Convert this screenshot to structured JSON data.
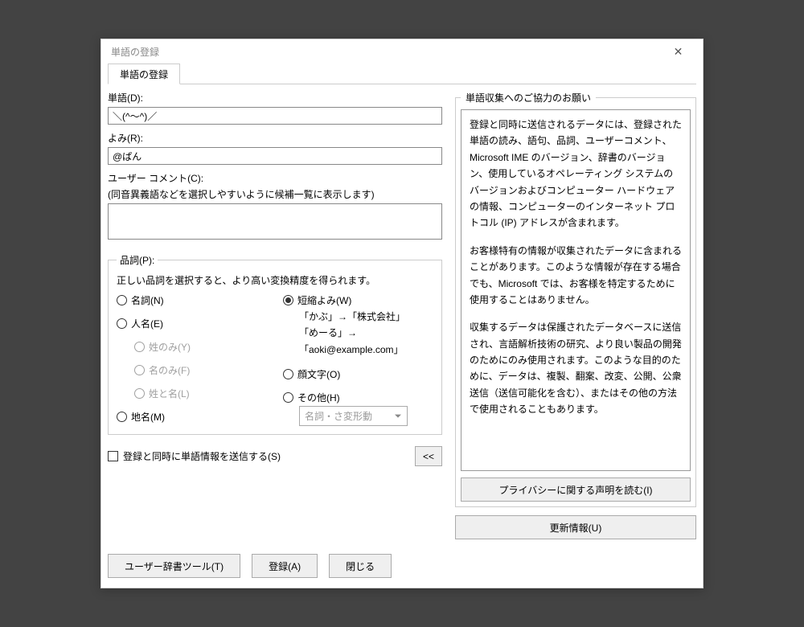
{
  "window": {
    "title": "単語の登録"
  },
  "tab": {
    "label": "単語の登録"
  },
  "fields": {
    "word_label": "単語(D):",
    "word_value": "＼(^～^)／",
    "yomi_label": "よみ(R):",
    "yomi_value": "@ぱん",
    "comment_label": "ユーザー コメント(C):",
    "comment_hint": "(同音異義語などを選択しやすいように候補一覧に表示します)",
    "comment_value": ""
  },
  "pos": {
    "legend": "品詞(P):",
    "instruction": "正しい品詞を選択すると、より高い変換精度を得られます。",
    "options": {
      "noun": "名詞(N)",
      "person": "人名(E)",
      "person_sei": "姓のみ(Y)",
      "person_mei": "名のみ(F)",
      "person_both": "姓と名(L)",
      "place": "地名(M)",
      "abbrev": "短縮よみ(W)",
      "abbrev_ex1": "「かぶ」→「株式会社」",
      "abbrev_ex2": "「めーる」→「aoki@example.com」",
      "kaomoji": "顔文字(O)",
      "other": "その他(H)",
      "subtype_placeholder": "名詞・さ変形動"
    },
    "selected": "abbrev"
  },
  "send_checkbox": "登録と同時に単語情報を送信する(S)",
  "collapse_label": "<<",
  "right": {
    "legend": "単語収集へのご協力のお願い",
    "paragraphs": [
      "登録と同時に送信されるデータには、登録された単語の読み、語句、品詞、ユーザーコメント、Microsoft IME のバージョン、辞書のバージョン、使用しているオペレーティング システムのバージョンおよびコンピューター ハードウェアの情報、コンピューターのインターネット プロトコル (IP) アドレスが含まれます。",
      "お客様特有の情報が収集されたデータに含まれることがあります。このような情報が存在する場合でも、Microsoft では、お客様を特定するために使用することはありません。",
      "収集するデータは保護されたデータベースに送信され、言語解析技術の研究、より良い製品の開発のためにのみ使用されます。このような目的のために、データは、複製、翻案、改変、公開、公衆送信（送信可能化を含む）、またはその他の方法で使用されることもあります。"
    ],
    "privacy_btn": "プライバシーに関する声明を読む(I)",
    "update_btn": "更新情報(U)"
  },
  "bottom": {
    "dict_tool": "ユーザー辞書ツール(T)",
    "register": "登録(A)",
    "close": "閉じる"
  }
}
